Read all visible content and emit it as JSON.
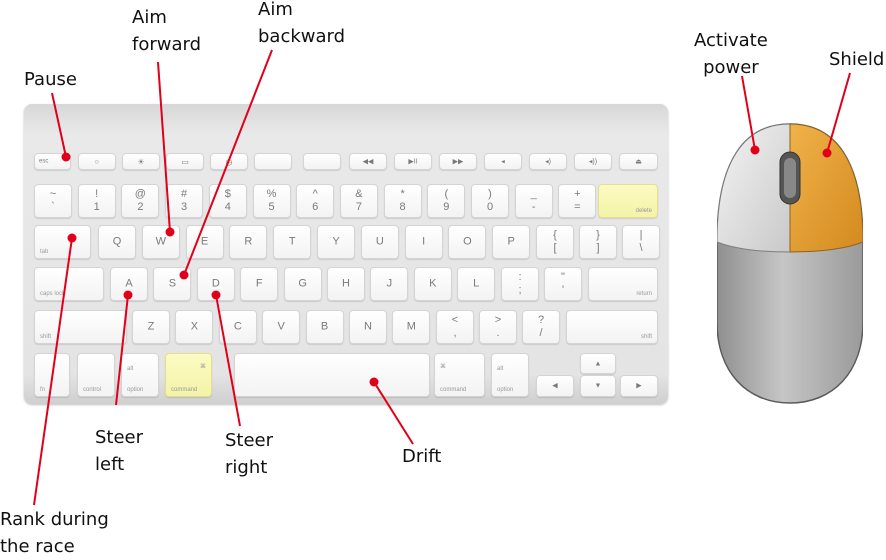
{
  "labels": {
    "pause": "Pause",
    "aim_forward": [
      "Aim",
      "forward"
    ],
    "aim_backward": [
      "Aim",
      "backward"
    ],
    "activate_power": [
      "Activate",
      "power"
    ],
    "shield": "Shield",
    "steer_left": [
      "Steer",
      "left"
    ],
    "steer_right": [
      "Steer",
      "right"
    ],
    "drift": "Drift",
    "rank": [
      "Rank during",
      "the race"
    ]
  },
  "keys": {
    "esc": "esc",
    "delete": "delete",
    "tab": "tab",
    "caps": "caps lock",
    "return": "return",
    "shift": "shift",
    "fn": "fn",
    "control": "control",
    "option": "option",
    "command": "command",
    "cmd_symbol": "⌘",
    "alt_symbol": "alt",
    "num_top": [
      "~",
      "!",
      "@",
      "#",
      "$",
      "%",
      "^",
      "&",
      "*",
      "(",
      ")",
      "_",
      "+"
    ],
    "num_bot": [
      "`",
      "1",
      "2",
      "3",
      "4",
      "5",
      "6",
      "7",
      "8",
      "9",
      "0",
      "-",
      "="
    ],
    "row_q": [
      "Q",
      "W",
      "E",
      "R",
      "T",
      "Y",
      "U",
      "I",
      "O",
      "P"
    ],
    "brackets": [
      "{\n[",
      "}\n]",
      "|\n\\"
    ],
    "row_a": [
      "A",
      "S",
      "D",
      "F",
      "G",
      "H",
      "J",
      "K",
      "L"
    ],
    "semi": [
      ":\n;",
      "\"\n'"
    ],
    "row_z": [
      "Z",
      "X",
      "C",
      "V",
      "B",
      "N",
      "M"
    ],
    "punct": [
      "<\n,",
      ">\n.",
      "?\n/"
    ]
  },
  "colors": {
    "highlight_key": "#f4f3a9",
    "mouse_right_button": "#e8a232",
    "mouse_left_button": "#dcdcdc",
    "mouse_body": "#bcbcbc",
    "marker": "#e0001a"
  }
}
